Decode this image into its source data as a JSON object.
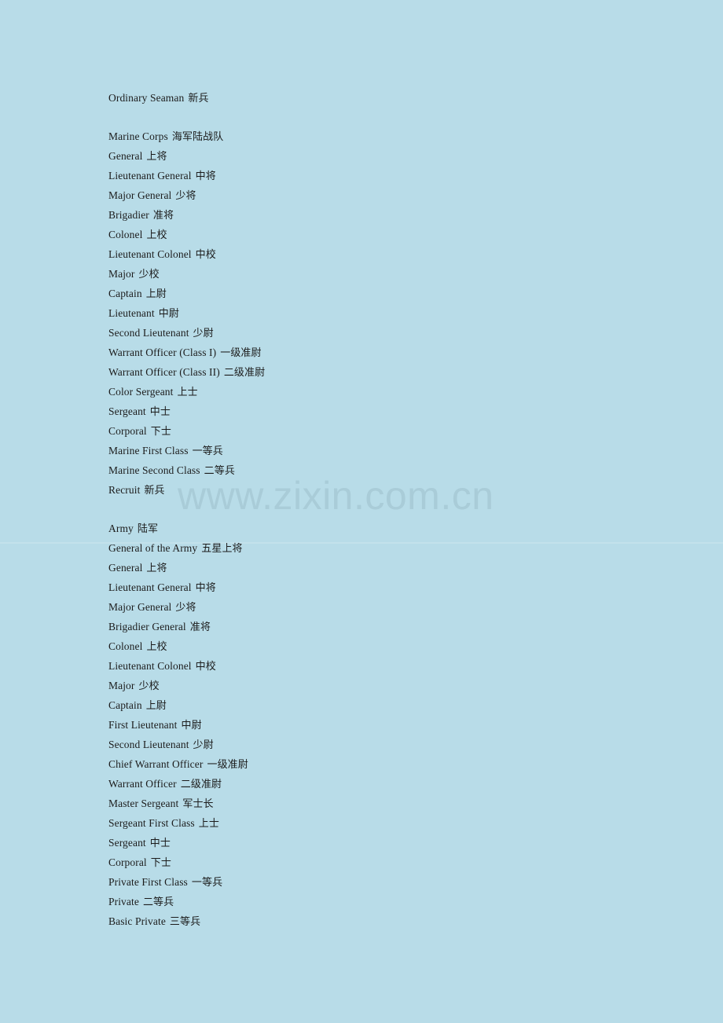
{
  "page": {
    "background_color": "#b8dce8",
    "text_color": "#1c1c1c"
  },
  "watermark": {
    "text": "www.zixin.com.cn",
    "color": "#a9ccd8"
  },
  "blocks": [
    {
      "name": "navy-tail",
      "lines": [
        {
          "en": "Ordinary Seaman",
          "zh": "新兵"
        }
      ]
    },
    {
      "name": "marine-corps",
      "lines": [
        {
          "en": "Marine Corps",
          "zh": "海军陆战队"
        },
        {
          "en": "General",
          "zh": "上将"
        },
        {
          "en": "Lieutenant General",
          "zh": "中将"
        },
        {
          "en": "Major General",
          "zh": "少将"
        },
        {
          "en": "Brigadier",
          "zh": "准将"
        },
        {
          "en": "Colonel",
          "zh": "上校"
        },
        {
          "en": "Lieutenant Colonel",
          "zh": "中校"
        },
        {
          "en": "Major",
          "zh": "少校"
        },
        {
          "en": "Captain",
          "zh": "上尉"
        },
        {
          "en": "Lieutenant",
          "zh": "中尉"
        },
        {
          "en": "Second Lieutenant",
          "zh": "少尉"
        },
        {
          "en": "Warrant Officer (Class I)",
          "zh": "一级准尉"
        },
        {
          "en": "Warrant Officer (Class II)",
          "zh": "二级准尉"
        },
        {
          "en": "Color Sergeant",
          "zh": "上士"
        },
        {
          "en": "Sergeant",
          "zh": "中士"
        },
        {
          "en": "Corporal",
          "zh": "下士"
        },
        {
          "en": "Marine First Class",
          "zh": "一等兵"
        },
        {
          "en": "Marine Second Class",
          "zh": "二等兵"
        },
        {
          "en": "Recruit",
          "zh": "新兵"
        }
      ]
    },
    {
      "name": "army",
      "lines": [
        {
          "en": "Army",
          "zh": "陆军"
        },
        {
          "en": "General of the Army",
          "zh": "五星上将"
        },
        {
          "en": "General",
          "zh": "上将"
        },
        {
          "en": "Lieutenant General",
          "zh": "中将"
        },
        {
          "en": "Major General",
          "zh": "少将"
        },
        {
          "en": "Brigadier General",
          "zh": "准将"
        },
        {
          "en": "Colonel",
          "zh": "上校"
        },
        {
          "en": "Lieutenant Colonel",
          "zh": "中校"
        },
        {
          "en": "Major",
          "zh": "少校"
        },
        {
          "en": "Captain",
          "zh": "上尉"
        },
        {
          "en": "First Lieutenant",
          "zh": "中尉"
        },
        {
          "en": "Second Lieutenant",
          "zh": "少尉"
        },
        {
          "en": "Chief Warrant Officer",
          "zh": "一级准尉"
        },
        {
          "en": "Warrant Officer",
          "zh": "二级准尉"
        },
        {
          "en": "Master Sergeant",
          "zh": "军士长"
        },
        {
          "en": "Sergeant First Class",
          "zh": "上士"
        },
        {
          "en": "Sergeant",
          "zh": "中士"
        },
        {
          "en": "Corporal",
          "zh": "下士"
        },
        {
          "en": "Private First Class",
          "zh": "一等兵"
        },
        {
          "en": "Private",
          "zh": "二等兵"
        },
        {
          "en": "Basic Private",
          "zh": "三等兵"
        }
      ]
    }
  ]
}
